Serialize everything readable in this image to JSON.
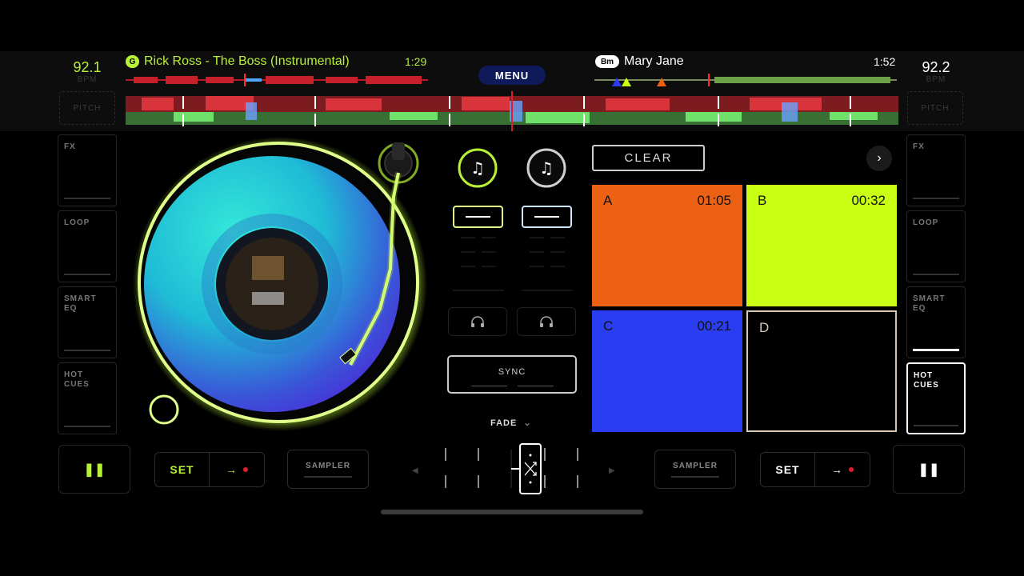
{
  "deck_left": {
    "bpm": "92.1",
    "bpm_unit": "BPM",
    "pitch_label": "PITCH",
    "key": "G",
    "title": "Rick Ross - The Boss (Instrumental)",
    "time": "1:29",
    "accent": "#b8f135",
    "fx_panes": [
      "FX",
      "LOOP",
      "SMART EQ",
      "HOT CUES"
    ],
    "set_label": "SET",
    "sampler_label": "SAMPLER"
  },
  "deck_right": {
    "bpm": "92.2",
    "bpm_unit": "BPM",
    "pitch_label": "PITCH",
    "key": "Bm",
    "title": "Mary Jane",
    "time": "1:52",
    "accent": "#ffffff",
    "fx_panes": [
      "FX",
      "LOOP",
      "SMART EQ",
      "HOT CUES"
    ],
    "set_label": "SET",
    "sampler_label": "SAMPLER"
  },
  "menu_label": "MENU",
  "mixer": {
    "sync_label": "SYNC",
    "fade_label": "FADE",
    "fade_chevron": "⌄"
  },
  "cues": {
    "clear_label": "CLEAR",
    "next_icon": "›",
    "pads": [
      {
        "letter": "A",
        "time": "01:05",
        "color": "#ed6115"
      },
      {
        "letter": "B",
        "time": "00:32",
        "color": "#c8ff14"
      },
      {
        "letter": "C",
        "time": "00:21",
        "color": "#2b3df0"
      },
      {
        "letter": "D",
        "time": "",
        "color": "#000000"
      }
    ]
  },
  "icons": {
    "pause": "❚❚",
    "arrow": "→",
    "left_arrow": "◂",
    "right_arrow": "▸"
  }
}
